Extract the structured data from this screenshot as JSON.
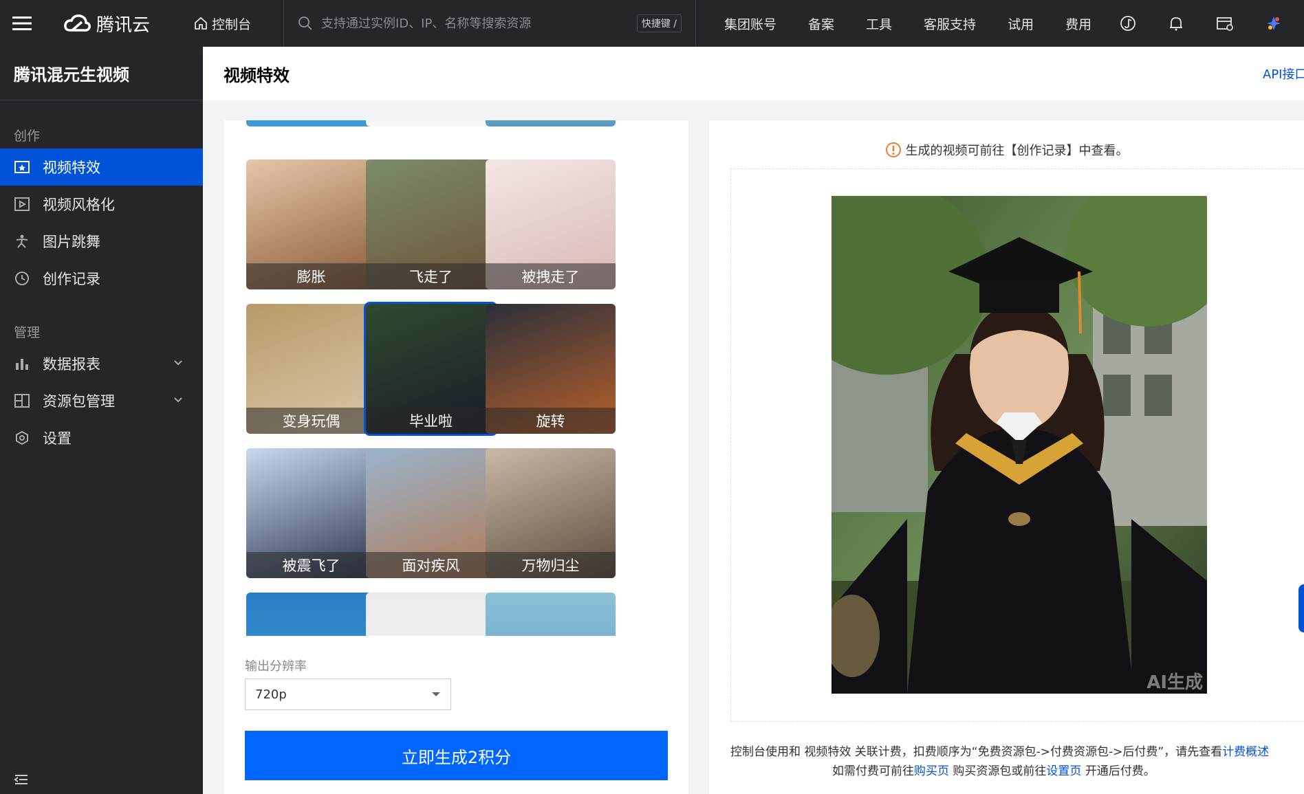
{
  "topnav": {
    "brand": "腾讯云",
    "console": "控制台",
    "search_placeholder": "支持通过实例ID、IP、名称等搜索资源",
    "shortcut": "快捷键 /",
    "links": [
      "集团账号",
      "备案",
      "工具",
      "客服支持",
      "试用",
      "费用"
    ],
    "icons": [
      "currency-icon",
      "bell-icon",
      "cart-icon",
      "app-icon"
    ]
  },
  "sidebar": {
    "title": "腾讯混元生视频",
    "groups": [
      {
        "label": "创作",
        "items": [
          {
            "label": "视频特效",
            "icon": "video-effect-icon",
            "active": true
          },
          {
            "label": "视频风格化",
            "icon": "video-style-icon"
          },
          {
            "label": "图片跳舞",
            "icon": "dance-icon"
          },
          {
            "label": "创作记录",
            "icon": "history-icon"
          }
        ]
      },
      {
        "label": "管理",
        "items": [
          {
            "label": "数据报表",
            "icon": "chart-icon",
            "expandable": true
          },
          {
            "label": "资源包管理",
            "icon": "package-icon",
            "expandable": true
          },
          {
            "label": "设置",
            "icon": "settings-icon"
          }
        ]
      }
    ]
  },
  "page": {
    "title": "视频特效",
    "api_link": "API接口"
  },
  "effects": {
    "cards": [
      {
        "label": "膨胀",
        "colors": [
          "#e6c6a8",
          "#8a5a3a"
        ]
      },
      {
        "label": "飞走了",
        "colors": [
          "#7a8c6a",
          "#6e5238"
        ]
      },
      {
        "label": "被拽走了",
        "colors": [
          "#f3e6e4",
          "#d8b8b4"
        ]
      },
      {
        "label": "变身玩偶",
        "colors": [
          "#b89a68",
          "#d9c7a8"
        ]
      },
      {
        "label": "毕业啦",
        "colors": [
          "#2e4a2e",
          "#1a1a2a"
        ],
        "selected": true
      },
      {
        "label": "旋转",
        "colors": [
          "#2c2f3a",
          "#b8612a"
        ]
      },
      {
        "label": "被震飞了",
        "colors": [
          "#c8d8ee",
          "#2a3450"
        ]
      },
      {
        "label": "面对疾风",
        "colors": [
          "#9ab4cc",
          "#b07a55"
        ]
      },
      {
        "label": "万物归尘",
        "colors": [
          "#c9b9a7",
          "#5e4a3a"
        ]
      }
    ],
    "partial_colors": [
      [
        "#2a7ec4",
        "#3f9ad6"
      ],
      [
        "#e8ebee",
        "#f6f7f8"
      ],
      [
        "#8cc0d8",
        "#5a9cbf"
      ]
    ]
  },
  "output": {
    "resolution_label": "输出分辨率",
    "resolution_value": "720p",
    "generate_button": "立即生成2积分"
  },
  "preview": {
    "notice": "生成的视频可前往【创作记录】中查看。",
    "watermark": "AI生成",
    "billing_line1_a": "控制台使用和 视频特效 关联计费，扣费顺序为“免费资源包->付费资源包->后付费”，请先查看",
    "billing_link1": "计费概述",
    "billing_line2_a": "如需付费可前往",
    "billing_link2": "购买页",
    "billing_line2_b": "购买资源包或前往",
    "billing_link3": "设置页",
    "billing_line2_c": "开通后付费。"
  }
}
